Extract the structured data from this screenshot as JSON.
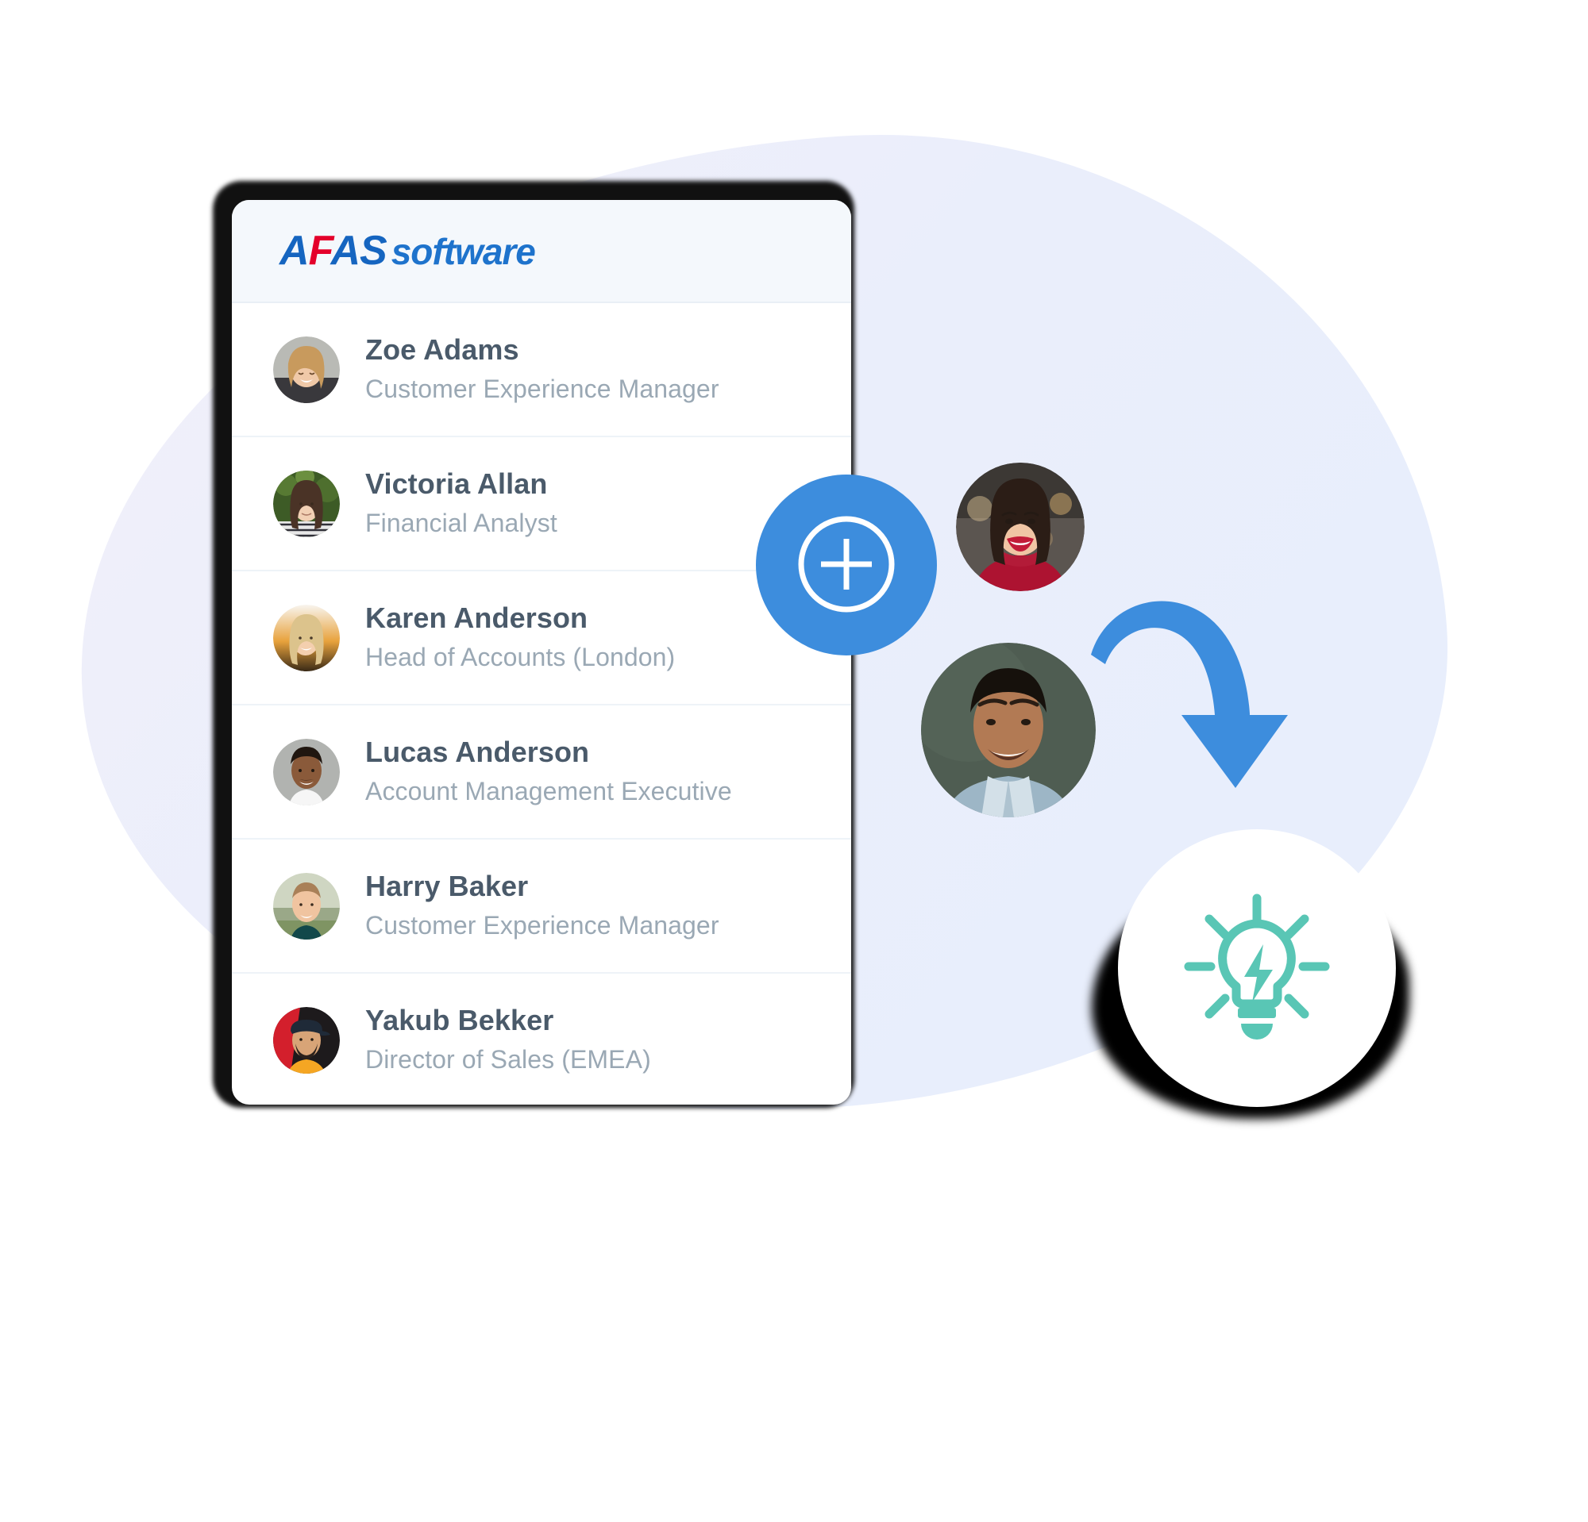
{
  "brand": {
    "logo_part_a": "A",
    "logo_part_f": "F",
    "logo_part_as": "AS",
    "logo_part_software": "software",
    "logo_blue": "#1565c0",
    "logo_red": "#e4002b"
  },
  "colors": {
    "accent_blue": "#3d8ddd",
    "arrow_blue": "#3d8ddd",
    "bulb_teal": "#59c6b5",
    "blob_lavender": "#e8eefb",
    "card_header_bg": "#f4f8fc",
    "name_text": "#4a5a6a",
    "role_text": "#9aa8b4"
  },
  "people": [
    {
      "name": "Zoe Adams",
      "role": "Customer Experience Manager",
      "avatar": "woman-blonde-smiling"
    },
    {
      "name": "Victoria Allan",
      "role": "Financial Analyst",
      "avatar": "woman-brunette-outdoors"
    },
    {
      "name": "Karen Anderson",
      "role": "Head of Accounts (London)",
      "avatar": "woman-blonde-sunset"
    },
    {
      "name": "Lucas Anderson",
      "role": "Account Management Executive",
      "avatar": "man-dark-hair-white-shirt"
    },
    {
      "name": "Harry Baker",
      "role": "Customer Experience Manager",
      "avatar": "man-short-hair-green-shirt"
    },
    {
      "name": "Yakub Bekker",
      "role": "Director of Sales (EMEA)",
      "avatar": "man-beard-cap-orange"
    }
  ],
  "actions": {
    "add_label": "Add person"
  },
  "floating": {
    "avatar_woman_alt": "Smiling woman in red top",
    "avatar_man_alt": "Smiling man in denim shirt",
    "arrow_alt": "Curved arrow pointing down",
    "idea_alt": "Lightbulb with lightning bolt"
  }
}
